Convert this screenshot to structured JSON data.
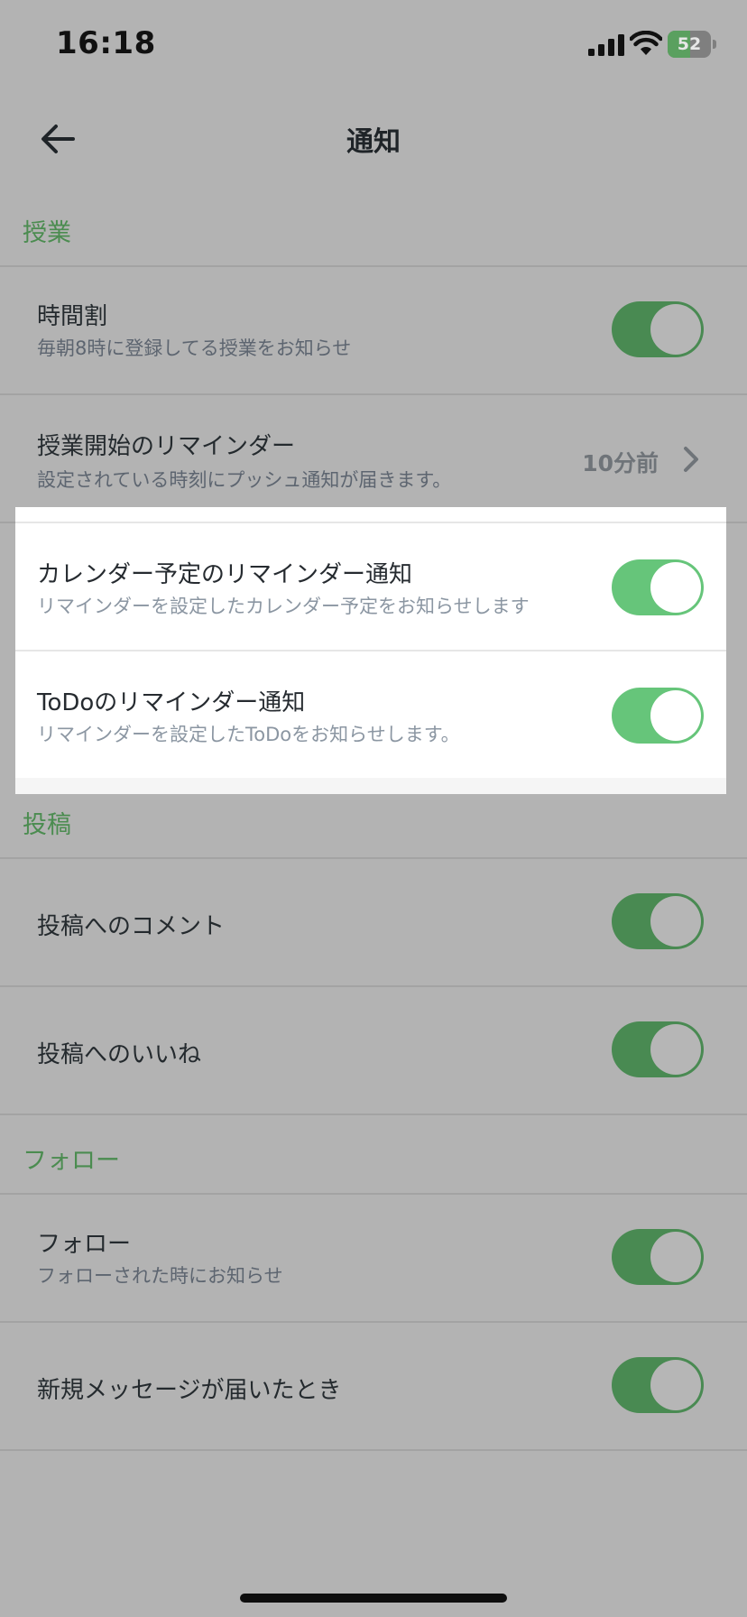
{
  "status_bar": {
    "time": "16:18",
    "signal_icon": "cellular-signal-icon",
    "wifi_icon": "wifi-icon",
    "battery_level": 52,
    "battery_text": "52",
    "battery_fill_percent": 52
  },
  "nav": {
    "back_icon": "arrow-left-icon",
    "title": "通知"
  },
  "sections": {
    "class": {
      "header": "授業",
      "timetable": {
        "title": "時間割",
        "subtitle": "毎朝8時に登録してる授業をお知らせ",
        "enabled": true
      },
      "class_reminder": {
        "title": "授業開始のリマインダー",
        "subtitle": "設定されている時刻にプッシュ通知が届きます。",
        "value": "10分前"
      }
    },
    "spotlight": {
      "calendar": {
        "title": "カレンダー予定のリマインダー通知",
        "subtitle": "リマインダーを設定したカレンダー予定をお知らせします",
        "enabled": true
      },
      "todo": {
        "title": "ToDoのリマインダー通知",
        "subtitle": "リマインダーを設定したToDoをお知らせします。",
        "enabled": true
      }
    },
    "posts": {
      "header": "投稿",
      "comment": {
        "title": "投稿へのコメント",
        "enabled": true
      },
      "like": {
        "title": "投稿へのいいね",
        "enabled": true
      }
    },
    "follow": {
      "header": "フォロー",
      "follow": {
        "title": "フォロー",
        "subtitle": "フォローされた時にお知らせ",
        "enabled": true
      },
      "message": {
        "title": "新規メッセージが届いたとき",
        "enabled": true
      }
    }
  },
  "colors": {
    "accent_green": "#4b8c50",
    "toggle_on_dim": "#498a52",
    "toggle_on_bright": "#66c57a",
    "overlay_background": "#b3b3b3",
    "spotlight_background": "#ffffff"
  }
}
